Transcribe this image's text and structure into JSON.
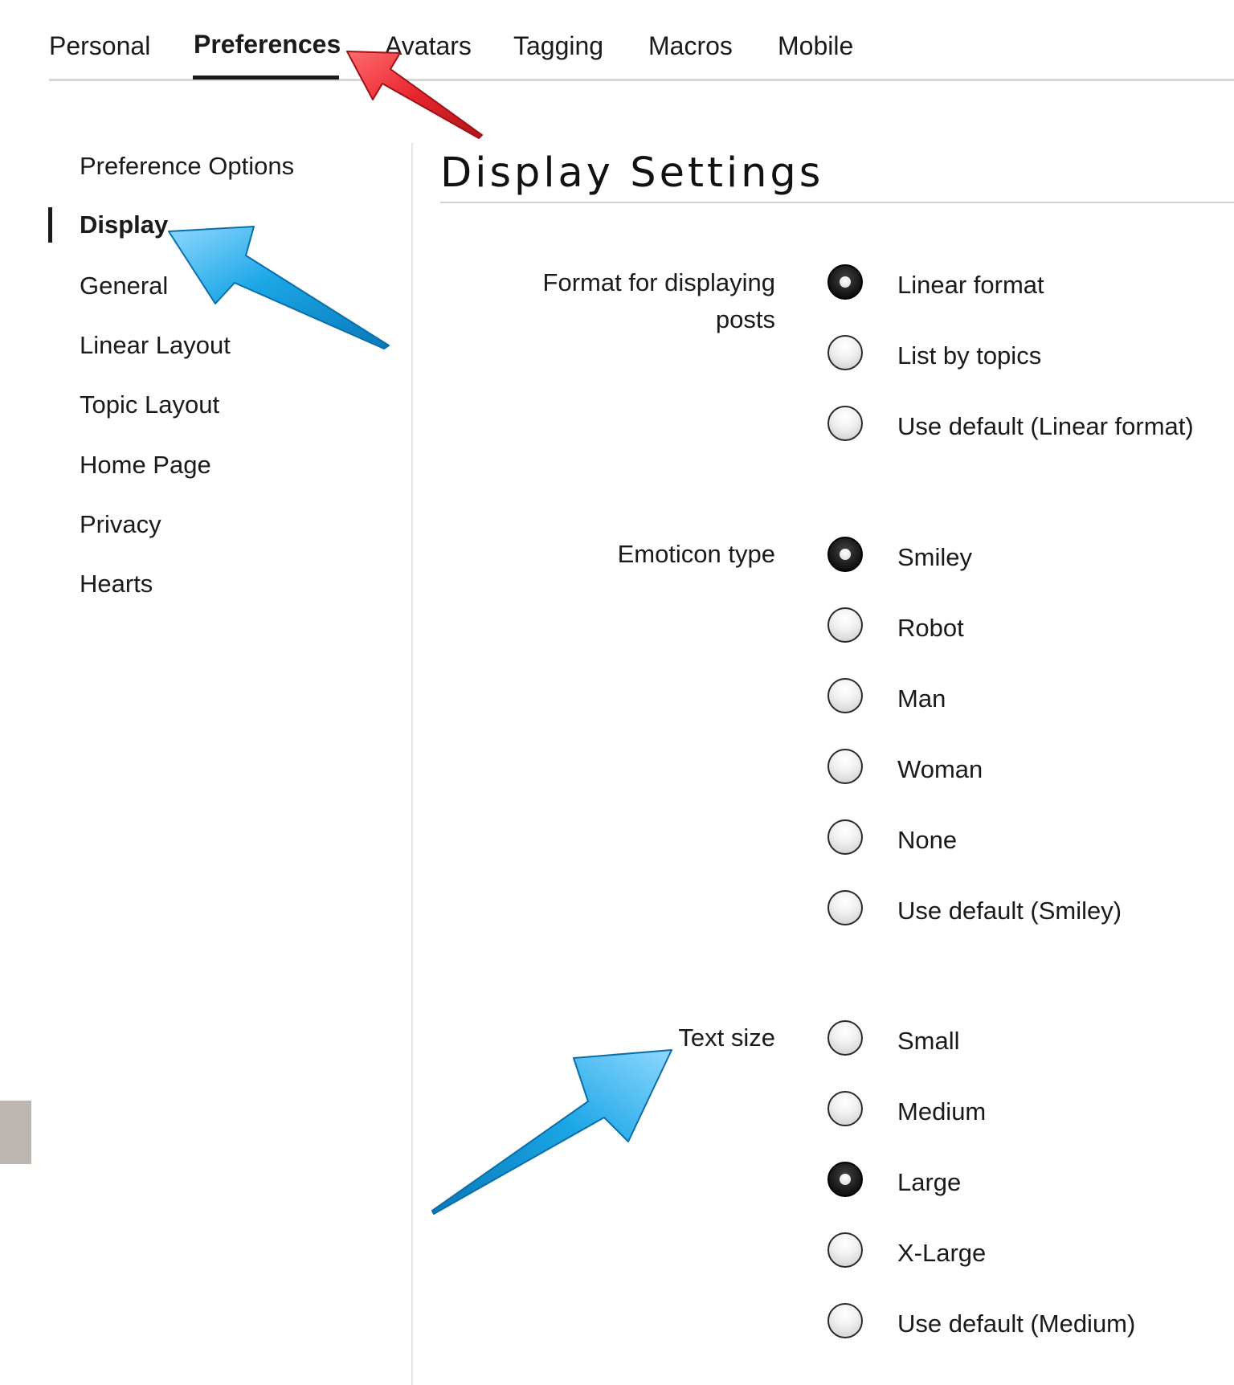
{
  "tabs": [
    {
      "label": "Personal",
      "active": false
    },
    {
      "label": "Preferences",
      "active": true
    },
    {
      "label": "Avatars",
      "active": false
    },
    {
      "label": "Tagging",
      "active": false
    },
    {
      "label": "Macros",
      "active": false
    },
    {
      "label": "Mobile",
      "active": false
    }
  ],
  "sidebar": {
    "items": [
      {
        "label": "Preference Options"
      },
      {
        "label": "Display",
        "active": true
      },
      {
        "label": "General"
      },
      {
        "label": "Linear Layout"
      },
      {
        "label": "Topic Layout"
      },
      {
        "label": "Home Page"
      },
      {
        "label": "Privacy"
      },
      {
        "label": "Hearts"
      }
    ]
  },
  "main": {
    "title": "Display Settings",
    "format": {
      "label_line1": "Format for displaying",
      "label_line2": "posts",
      "options": [
        {
          "label": "Linear format",
          "checked": true
        },
        {
          "label": "List by topics",
          "checked": false
        },
        {
          "label": "Use default (Linear format)",
          "checked": false
        }
      ]
    },
    "emoticon": {
      "label": "Emoticon type",
      "options": [
        {
          "label": "Smiley",
          "checked": true
        },
        {
          "label": "Robot",
          "checked": false
        },
        {
          "label": "Man",
          "checked": false
        },
        {
          "label": "Woman",
          "checked": false
        },
        {
          "label": "None",
          "checked": false
        },
        {
          "label": "Use default (Smiley)",
          "checked": false
        }
      ]
    },
    "textsize": {
      "label": "Text size",
      "options": [
        {
          "label": "Small",
          "checked": false
        },
        {
          "label": "Medium",
          "checked": false
        },
        {
          "label": "Large",
          "checked": true
        },
        {
          "label": "X-Large",
          "checked": false
        },
        {
          "label": "Use default (Medium)",
          "checked": false
        }
      ]
    }
  },
  "colors": {
    "red_arrow": "#e8262d",
    "blue_arrow": "#1aa6e6",
    "text": "#1a1a1a"
  }
}
